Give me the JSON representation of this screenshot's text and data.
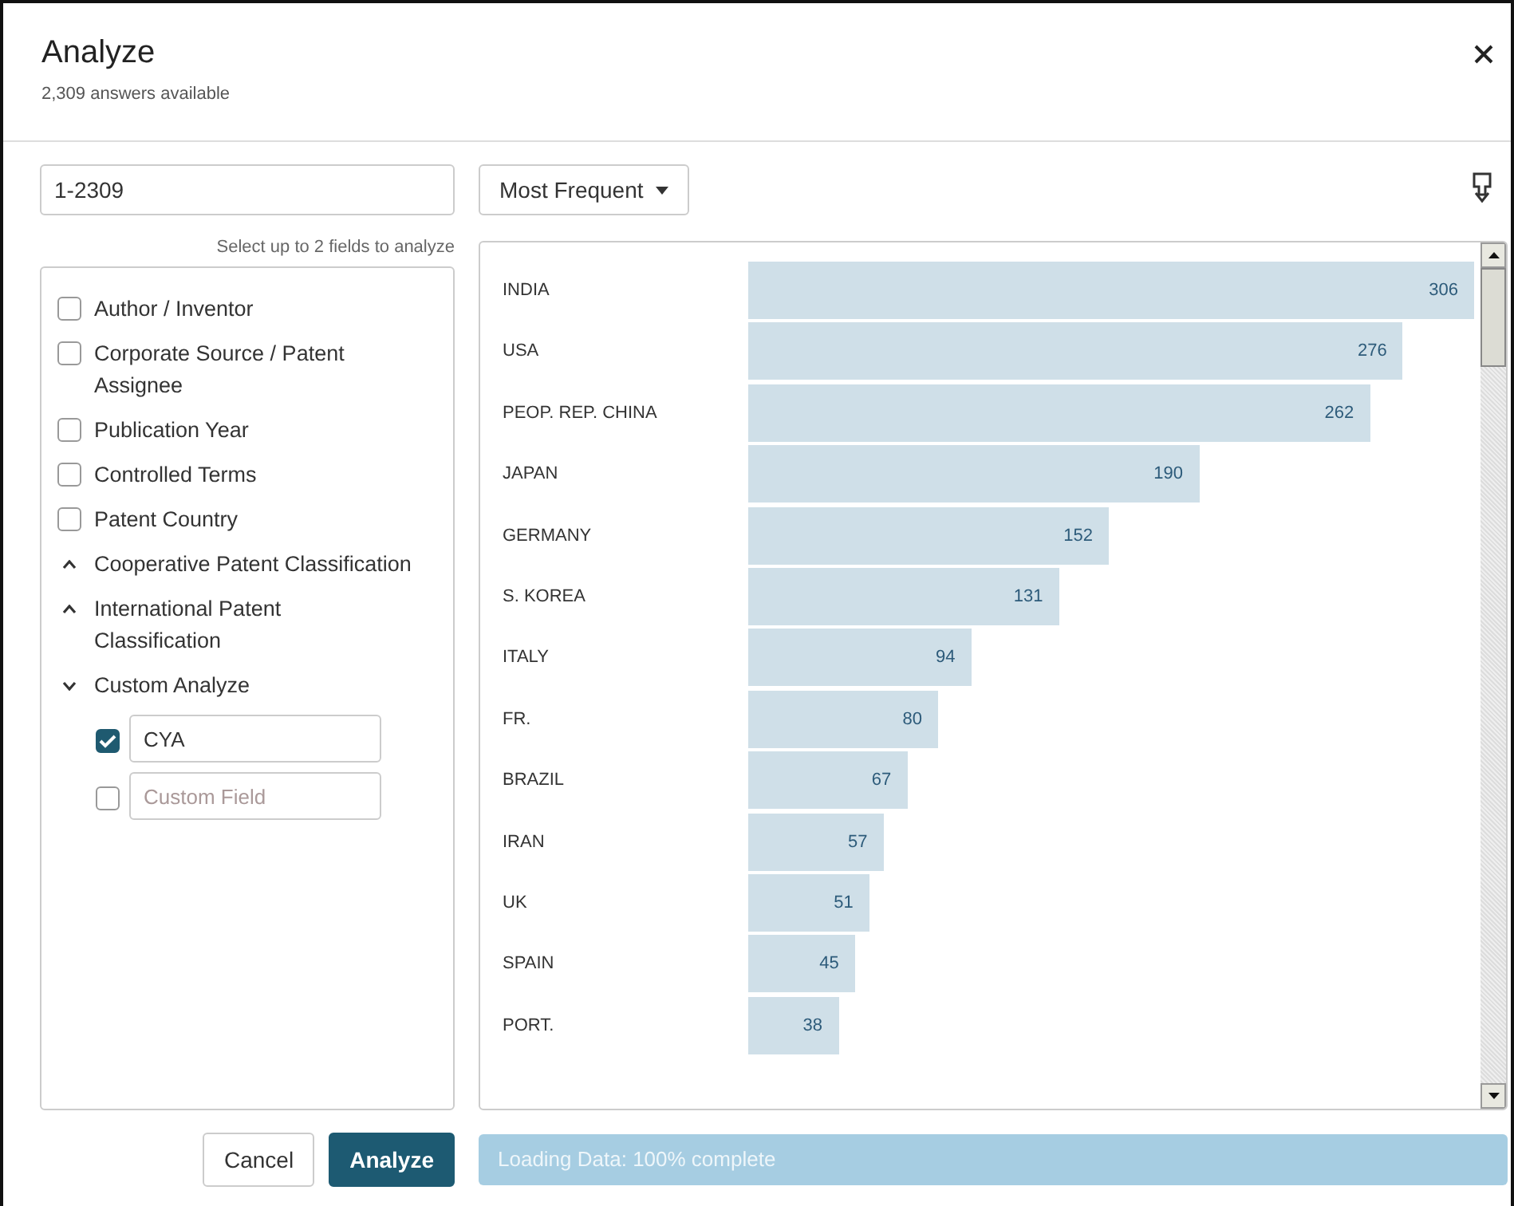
{
  "dialog": {
    "title": "Analyze",
    "subtitle": "2,309 answers available"
  },
  "range_field": {
    "value": "1-2309"
  },
  "sort_dropdown": {
    "label": "Most Frequent"
  },
  "hint": "Select up to 2 fields to analyze",
  "fields": [
    {
      "kind": "checkbox",
      "label": "Author / Inventor",
      "checked": false
    },
    {
      "kind": "checkbox",
      "label": "Corporate Source / Patent Assignee",
      "checked": false
    },
    {
      "kind": "checkbox",
      "label": "Publication Year",
      "checked": false
    },
    {
      "kind": "checkbox",
      "label": "Controlled Terms",
      "checked": false
    },
    {
      "kind": "checkbox",
      "label": "Patent Country",
      "checked": false
    },
    {
      "kind": "group",
      "label": "Cooperative Patent Classification",
      "expanded": false
    },
    {
      "kind": "group",
      "label": "International Patent Classification",
      "expanded": false
    },
    {
      "kind": "group",
      "label": "Custom Analyze",
      "expanded": true,
      "children": [
        {
          "kind": "field",
          "checked": true,
          "value": "CYA"
        },
        {
          "kind": "field",
          "checked": false,
          "placeholder": "Custom Field"
        }
      ]
    }
  ],
  "chart": {
    "chart_data": {
      "type": "bar",
      "orientation": "horizontal",
      "data_labels": true,
      "categories": [
        "INDIA",
        "USA",
        "PEOP. REP. CHINA",
        "JAPAN",
        "GERMANY",
        "S. KOREA",
        "ITALY",
        "FR.",
        "BRAZIL",
        "IRAN",
        "UK",
        "SPAIN",
        "PORT."
      ],
      "values": [
        306,
        276,
        262,
        190,
        152,
        131,
        94,
        80,
        67,
        57,
        51,
        45,
        38
      ]
    }
  },
  "buttons": [
    {
      "label": "Cancel",
      "kind": "secondary"
    },
    {
      "label": "Analyze",
      "kind": "primary"
    }
  ],
  "progress": {
    "label": "Loading Data: 100% complete",
    "level": 1
  }
}
